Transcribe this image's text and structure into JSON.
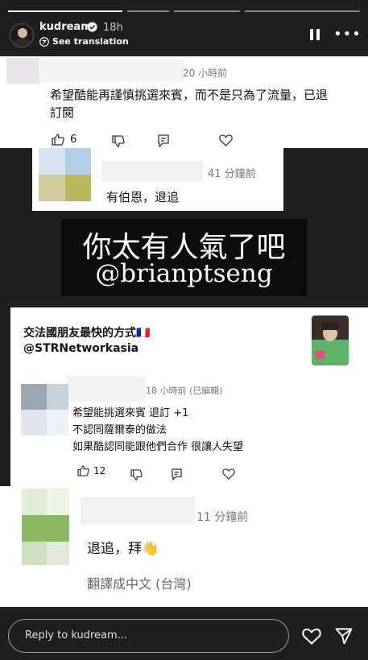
{
  "story": {
    "username": "kudream",
    "time_ago": "18h",
    "see_translation": "See translation",
    "reply_placeholder": "Reply to kudream..."
  },
  "comment1": {
    "time": "20 小時前",
    "text_line1": "希望酷能再謹慎挑選來賓，而不是只為了流量，已退",
    "text_line2": "訂閱",
    "likes": "6"
  },
  "comment2": {
    "time": "41 分鐘前",
    "text": "有伯恩，退追"
  },
  "banner": {
    "line1": "你太有人氣了吧",
    "line2": "@brianptseng"
  },
  "video": {
    "title": "交法國朋友最快的方式🇫🇷",
    "channel": "@STRNetworkasia"
  },
  "comment3": {
    "time": "18 小時前 (已編輯)",
    "line1": "希望能挑選來賓 退訂 +1",
    "line2": "不認同薩爾泰的做法",
    "line3": "如果酷認同能跟他們合作 很讓人失望",
    "likes": "12"
  },
  "comment4": {
    "time": "11 分鐘前",
    "text": "退追，拜👋",
    "translate": "翻譯成中文 (台灣)"
  },
  "icons": [
    "verified-icon",
    "translate-icon",
    "pause-icon",
    "more-icon",
    "thumbs-up-icon",
    "thumbs-down-icon",
    "reply-icon",
    "heart-icon",
    "send-icon"
  ]
}
